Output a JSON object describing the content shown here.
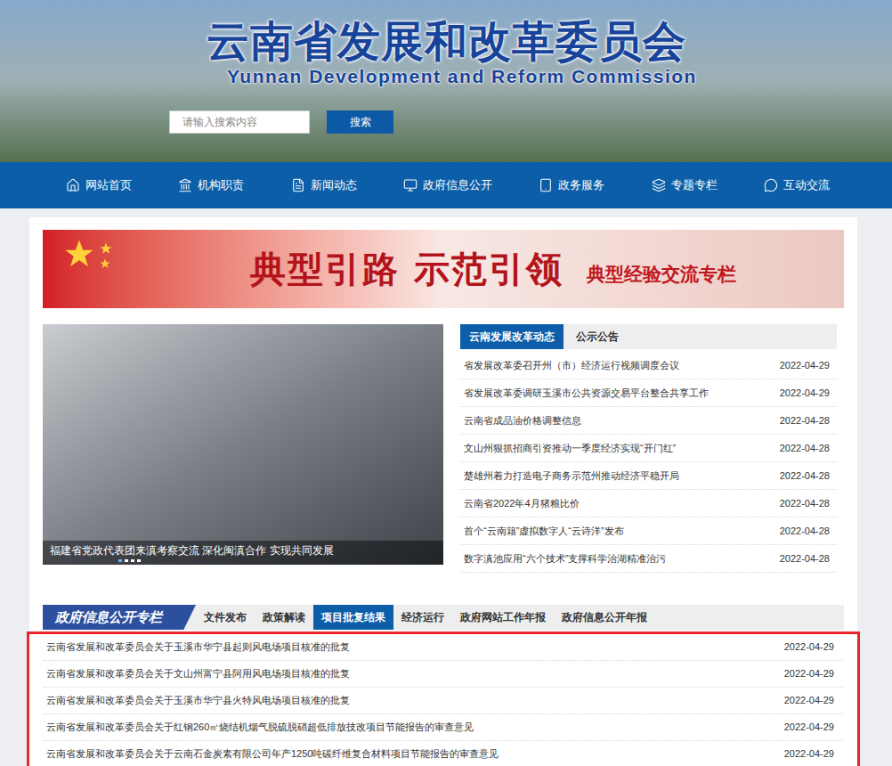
{
  "header": {
    "title": "云南省发展和改革委员会",
    "subtitle": "Yunnan Development and Reform Commission",
    "search": {
      "placeholder": "请输入搜索内容",
      "button": "搜索"
    }
  },
  "nav": {
    "items": [
      "网站首页",
      "机构职责",
      "新闻动态",
      "政府信息公开",
      "政务服务",
      "专题专栏",
      "互动交流"
    ]
  },
  "banner": {
    "title": "典型引路 示范引领",
    "subtitle": "典型经验交流专栏"
  },
  "slideshow": {
    "caption": "福建省党政代表团来滇考察交流 深化闽滇合作 实现共同发展",
    "dots": [
      {
        "selected": true
      },
      {
        "selected": false
      },
      {
        "selected": false
      },
      {
        "selected": false
      }
    ]
  },
  "news": {
    "tabs": [
      {
        "label": "云南发展改革动态",
        "selected": true
      },
      {
        "label": "公示公告",
        "selected": false
      }
    ],
    "rows": [
      {
        "title": "省发展改革委召开州（市）经济运行视频调度会议",
        "date": "2022-04-29"
      },
      {
        "title": "省发展改革委调研玉溪市公共资源交易平台整合共享工作",
        "date": "2022-04-29"
      },
      {
        "title": "云南省成品油价格调整信息",
        "date": "2022-04-28"
      },
      {
        "title": "文山州狠抓招商引资推动一季度经济实现“开门红”",
        "date": "2022-04-28"
      },
      {
        "title": "楚雄州着力打造电子商务示范州推动经济平稳开局",
        "date": "2022-04-28"
      },
      {
        "title": "云南省2022年4月猪粮比价",
        "date": "2022-04-28"
      },
      {
        "title": "首个“云南籍”虚拟数字人“云诗洋”发布",
        "date": "2022-04-28"
      },
      {
        "title": "数字滇池应用“六个技术”支撑科学治湖精准治污",
        "date": "2022-04-28"
      }
    ]
  },
  "info": {
    "heading": "政府信息公开专栏",
    "tabs": [
      {
        "label": "文件发布",
        "selected": false
      },
      {
        "label": "政策解读",
        "selected": false
      },
      {
        "label": "项目批复结果",
        "selected": true
      },
      {
        "label": "经济运行",
        "selected": false
      },
      {
        "label": "政府网站工作年报",
        "selected": false
      },
      {
        "label": "政府信息公开年报",
        "selected": false
      }
    ],
    "rows": [
      {
        "title": "云南省发展和改革委员会关于玉溪市华宁县起则风电场项目核准的批复",
        "date": "2022-04-29"
      },
      {
        "title": "云南省发展和改革委员会关于文山州富宁县阿用风电场项目核准的批复",
        "date": "2022-04-29"
      },
      {
        "title": "云南省发展和改革委员会关于玉溪市华宁县火特风电场项目核准的批复",
        "date": "2022-04-29"
      },
      {
        "title": "云南省发展和改革委员会关于红钢260㎡烧结机烟气脱硫脱硝超低排放技改项目节能报告的审查意见",
        "date": "2022-04-29"
      },
      {
        "title": "云南省发展和改革委员会关于云南石金炭素有限公司年产1250吨碳纤维复合材料项目节能报告的审查意见",
        "date": "2022-04-29"
      }
    ]
  }
}
